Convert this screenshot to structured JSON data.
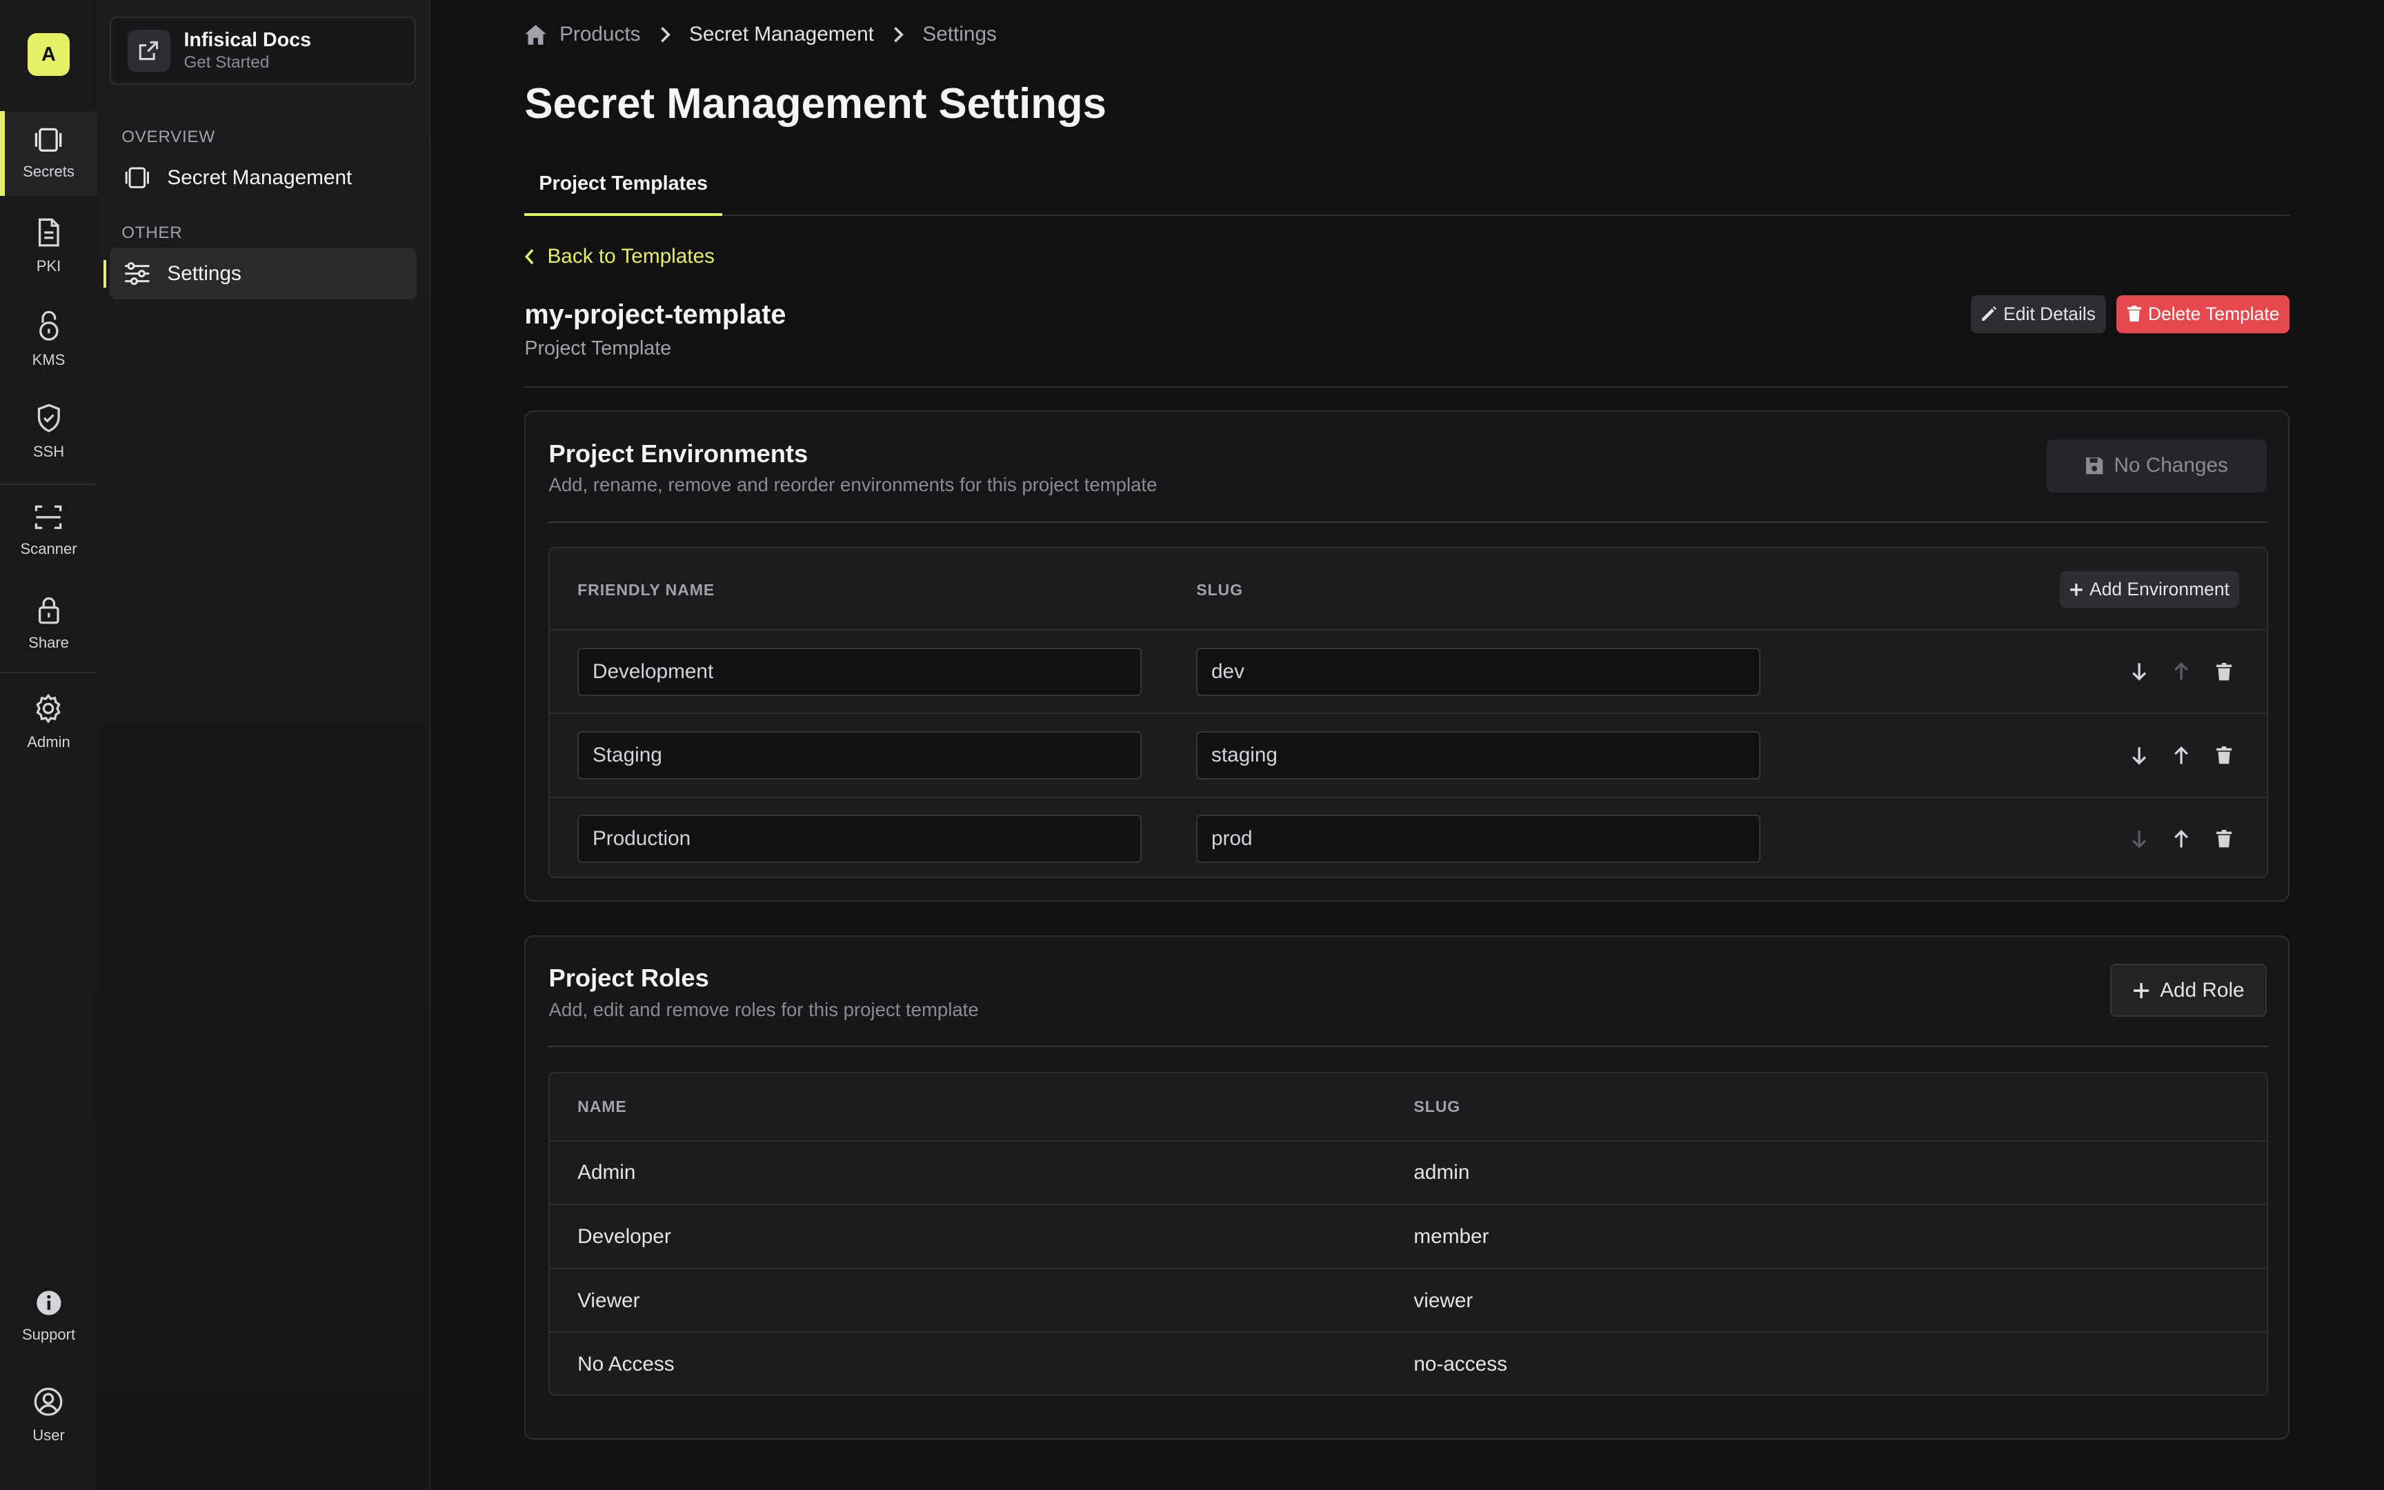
{
  "org": {
    "avatar_letter": "A"
  },
  "rail": {
    "items": [
      {
        "label": "Secrets",
        "icon": "secrets-icon"
      },
      {
        "label": "PKI",
        "icon": "pki-document-icon"
      },
      {
        "label": "KMS",
        "icon": "kms-lock-icon"
      },
      {
        "label": "SSH",
        "icon": "ssh-shield-icon"
      },
      {
        "label": "Scanner",
        "icon": "scanner-icon"
      },
      {
        "label": "Share",
        "icon": "share-lock-icon"
      },
      {
        "label": "Admin",
        "icon": "gear-icon"
      }
    ],
    "bottom": [
      {
        "label": "Support",
        "icon": "info-icon"
      },
      {
        "label": "User",
        "icon": "user-icon"
      }
    ]
  },
  "sidebar": {
    "docs_title": "Infisical Docs",
    "docs_subtitle": "Get Started",
    "overview_label": "OVERVIEW",
    "overview_item": "Secret Management",
    "other_label": "OTHER",
    "other_item": "Settings"
  },
  "breadcrumb": {
    "home": "Products",
    "section": "Secret Management",
    "current": "Settings"
  },
  "page": {
    "title": "Secret Management Settings",
    "tab": "Project Templates"
  },
  "template": {
    "back_label": "Back to Templates",
    "name": "my-project-template",
    "type": "Project Template",
    "edit_label": "Edit Details",
    "delete_label": "Delete Template"
  },
  "environments": {
    "title": "Project Environments",
    "subtitle": "Add, rename, remove and reorder environments for this project template",
    "save_label": "No Changes",
    "col_name": "FRIENDLY NAME",
    "col_slug": "SLUG",
    "add_label": "Add Environment",
    "rows": [
      {
        "name": "Development",
        "slug": "dev"
      },
      {
        "name": "Staging",
        "slug": "staging"
      },
      {
        "name": "Production",
        "slug": "prod"
      }
    ]
  },
  "roles": {
    "title": "Project Roles",
    "subtitle": "Add, edit and remove roles for this project template",
    "add_label": "Add Role",
    "col_name": "NAME",
    "col_slug": "SLUG",
    "rows": [
      {
        "name": "Admin",
        "slug": "admin"
      },
      {
        "name": "Developer",
        "slug": "member"
      },
      {
        "name": "Viewer",
        "slug": "viewer"
      },
      {
        "name": "No Access",
        "slug": "no-access"
      }
    ]
  },
  "colors": {
    "accent": "#e6f066",
    "danger": "#e5484d",
    "background": "#111112"
  }
}
